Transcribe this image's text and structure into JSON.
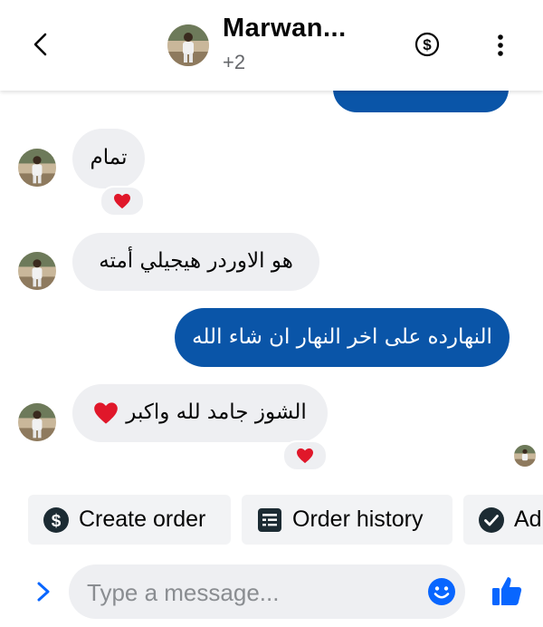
{
  "header": {
    "title": "Marwan...",
    "subtitle": "+2"
  },
  "messages": [
    {
      "direction": "incoming",
      "text": "تمام",
      "reaction": "heart"
    },
    {
      "direction": "incoming",
      "text": "هو الاوردر هيجيلي أمته"
    },
    {
      "direction": "outgoing",
      "text": "النهارده على اخر النهار ان شاء الله"
    },
    {
      "direction": "incoming",
      "text": "الشوز جامد لله واكبر",
      "emoji": "❤️",
      "reaction": "heart"
    }
  ],
  "actions": [
    {
      "label": "Create order",
      "icon": "dollar-circle-icon"
    },
    {
      "label": "Order history",
      "icon": "receipt-icon"
    },
    {
      "label": "Ad",
      "icon": "check-circle-icon"
    }
  ],
  "composer": {
    "placeholder": "Type a message..."
  },
  "colors": {
    "accent": "#0a55a8",
    "reaction_heart": "#e0172a",
    "incoming_bubble": "#eeeff2"
  }
}
